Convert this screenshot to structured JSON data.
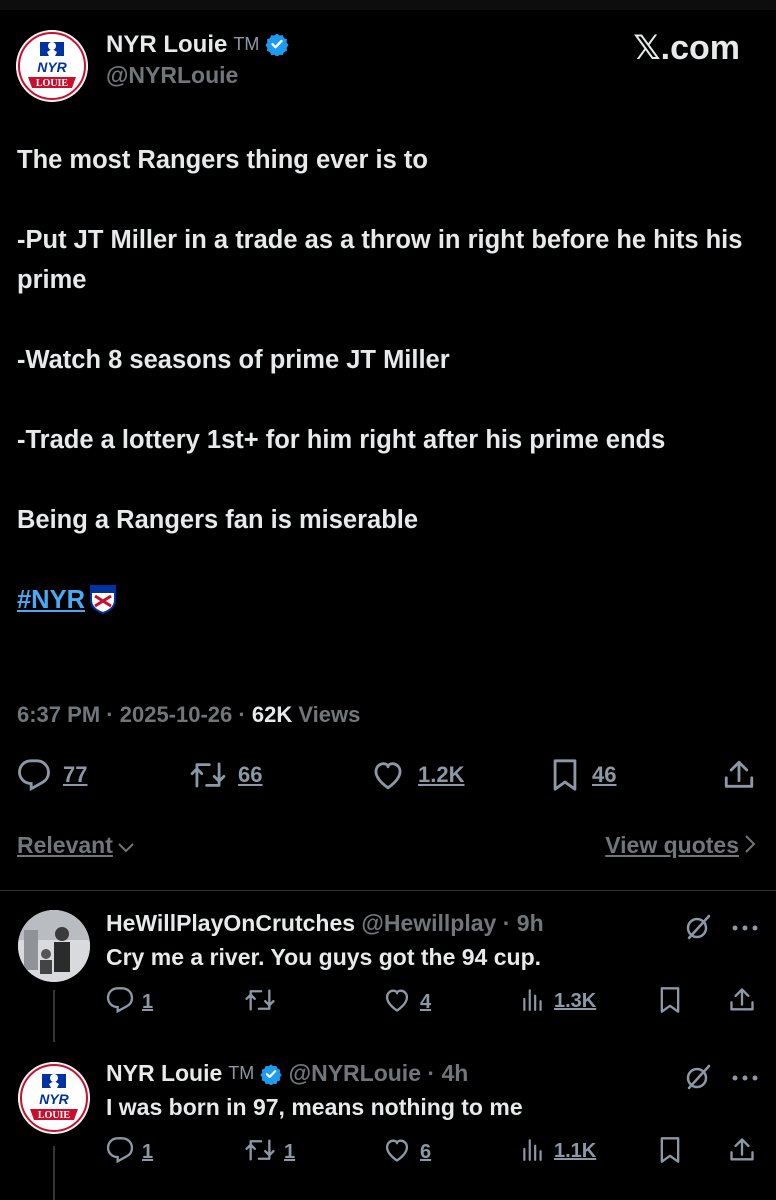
{
  "main_tweet": {
    "author_name": "NYR Louie",
    "tm": "TM",
    "handle": "@NYRLouie",
    "avatar_text": "LOUIE",
    "site_label": "𝕏.com",
    "lines": [
      "The most Rangers thing ever is to",
      "",
      "-Put JT Miller in a trade as a throw in right before he hits his prime",
      "",
      "-Watch 8 seasons of prime JT Miller",
      "",
      "-Trade a lottery 1st+ for him right after his prime ends",
      "",
      "Being a Rangers fan is miserable",
      ""
    ],
    "hashtag": "#NYR",
    "time": "6:37 PM",
    "date": "2025-10-26",
    "views_count": "62K",
    "views_label": "Views",
    "replies": "77",
    "reposts": "66",
    "likes": "1.2K",
    "bookmarks": "46"
  },
  "sort": {
    "relevant_label": "Relevant",
    "view_quotes_label": "View quotes"
  },
  "replies": [
    {
      "author_name": "HeWillPlayOnCrutches",
      "handle": "@Hewillplay",
      "time": "9h",
      "text": "Cry me a river. You guys got the 94 cup.",
      "replies": "1",
      "reposts": "",
      "likes": "4",
      "views": "1.3K"
    },
    {
      "author_name": "NYR Louie",
      "tm": "TM",
      "handle": "@NYRLouie",
      "time": "4h",
      "text": "I was born in 97, means nothing to me",
      "replies": "1",
      "reposts": "1",
      "likes": "6",
      "views": "1.1K"
    }
  ],
  "colors": {
    "background": "#000000",
    "text": "#e7e9ea",
    "muted": "#71767b",
    "link": "#4aa9f5",
    "verified": "#1d9bf0"
  }
}
